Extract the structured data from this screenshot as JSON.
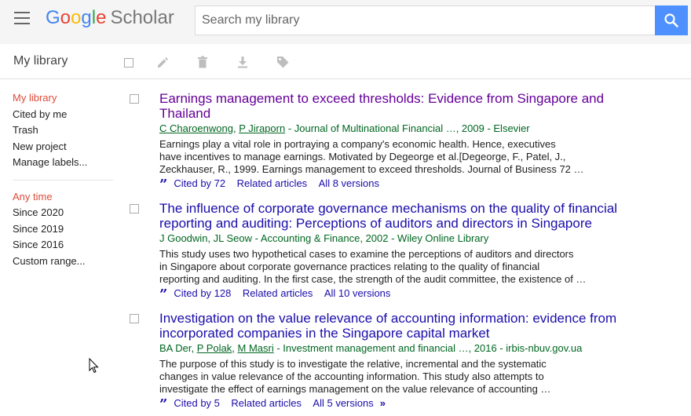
{
  "header": {
    "logo_letters": [
      {
        "char": "G",
        "color": "#4285f4"
      },
      {
        "char": "o",
        "color": "#ea4335"
      },
      {
        "char": "o",
        "color": "#fbbc05"
      },
      {
        "char": "g",
        "color": "#4285f4"
      },
      {
        "char": "l",
        "color": "#34a853"
      },
      {
        "char": "e",
        "color": "#ea4335"
      }
    ],
    "logo_suffix": "Scholar",
    "search_placeholder": "Search my library",
    "search_value": "",
    "search_button_color": "#4d90fe"
  },
  "toolbar": {
    "title": "My library",
    "icons": [
      "checkbox-icon",
      "pencil-icon",
      "trash-icon",
      "download-icon",
      "label-icon"
    ]
  },
  "sidebar": {
    "library_items": [
      {
        "label": "My library",
        "active": true
      },
      {
        "label": "Cited by me",
        "active": false
      },
      {
        "label": "Trash",
        "active": false
      },
      {
        "label": "New project",
        "active": false
      },
      {
        "label": "Manage labels...",
        "active": false
      }
    ],
    "time_items": [
      {
        "label": "Any time",
        "active": true
      },
      {
        "label": "Since 2020",
        "active": false
      },
      {
        "label": "Since 2019",
        "active": false
      },
      {
        "label": "Since 2016",
        "active": false
      },
      {
        "label": "Custom range...",
        "active": false
      }
    ],
    "active_color": "#dd4b39"
  },
  "results": [
    {
      "title_lines": [
        "Earnings management to exceed thresholds: Evidence from Singapore and",
        "Thailand"
      ],
      "visited": true,
      "authors": [
        {
          "name": "C Charoenwong",
          "linked": true
        },
        {
          "name": "P Jiraporn",
          "linked": true
        }
      ],
      "source": " - Journal of Multinational Financial …, 2009 - Elsevier",
      "snippet_lines": [
        "Earnings play a vital role in portraying a company's economic health. Hence, executives",
        "have incentives to manage earnings. Motivated by Degeorge et al.[Degeorge, F., Patel, J.,",
        "Zeckhauser, R., 1999. Earnings management to exceed thresholds. Journal of Business 72 …"
      ],
      "cited_by": "Cited by 72",
      "related": "Related articles",
      "versions": "All 8 versions",
      "has_more": false
    },
    {
      "title_lines": [
        "The influence of corporate governance mechanisms on the quality of financial",
        "reporting and auditing: Perceptions of auditors and directors in Singapore"
      ],
      "visited": false,
      "authors": [
        {
          "name": "J Goodwin",
          "linked": false
        },
        {
          "name": "JL Seow",
          "linked": false
        }
      ],
      "source": " - Accounting & Finance, 2002 - Wiley Online Library",
      "snippet_lines": [
        "This study uses two hypothetical cases to examine the perceptions of auditors and directors",
        "in Singapore about corporate governance practices relating to the quality of financial",
        "reporting and auditing. In the first case, the strength of the audit committee, the existence of …"
      ],
      "cited_by": "Cited by 128",
      "related": "Related articles",
      "versions": "All 10 versions",
      "has_more": false
    },
    {
      "title_lines": [
        "Investigation on the value relevance of accounting information: evidence from",
        "incorporated companies in the Singapore capital market"
      ],
      "visited": false,
      "authors": [
        {
          "name": "BA Der",
          "linked": false
        },
        {
          "name": "P Polak",
          "linked": true
        },
        {
          "name": "M Masri",
          "linked": true
        }
      ],
      "source": " - Investment management and financial …, 2016 - irbis-nbuv.gov.ua",
      "snippet_lines": [
        "The purpose of this study is to investigate the relative, incremental and the systematic",
        "changes in value relevance of the accounting information. This study also attempts to",
        "investigate the effect of earnings management on the value relevance of accounting …"
      ],
      "cited_by": "Cited by 5",
      "related": "Related articles",
      "versions": "All 5 versions",
      "has_more": true
    }
  ],
  "colors": {
    "link": "#1a0dab",
    "visited": "#660099",
    "meta_green": "#006621"
  }
}
